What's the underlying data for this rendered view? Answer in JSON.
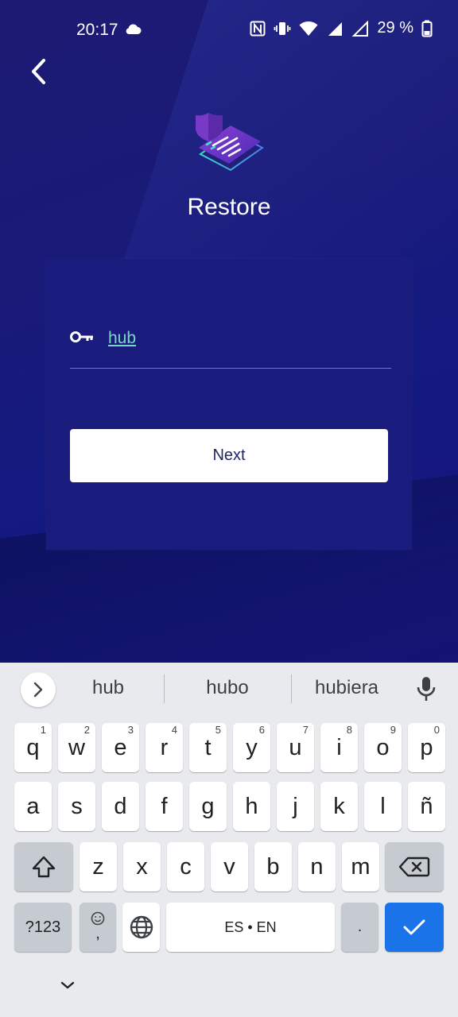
{
  "status_bar": {
    "time": "20:17",
    "battery": "29 %"
  },
  "screen": {
    "title": "Restore",
    "field_value": "hub",
    "next_label": "Next"
  },
  "keyboard": {
    "suggestions": [
      "hub",
      "hubo",
      "hubiera"
    ],
    "row1": [
      {
        "k": "q",
        "h": "1"
      },
      {
        "k": "w",
        "h": "2"
      },
      {
        "k": "e",
        "h": "3"
      },
      {
        "k": "r",
        "h": "4"
      },
      {
        "k": "t",
        "h": "5"
      },
      {
        "k": "y",
        "h": "6"
      },
      {
        "k": "u",
        "h": "7"
      },
      {
        "k": "i",
        "h": "8"
      },
      {
        "k": "o",
        "h": "9"
      },
      {
        "k": "p",
        "h": "0"
      }
    ],
    "row2": [
      "a",
      "s",
      "d",
      "f",
      "g",
      "h",
      "j",
      "k",
      "l",
      "ñ"
    ],
    "row3": [
      "z",
      "x",
      "c",
      "v",
      "b",
      "n",
      "m"
    ],
    "symbols_label": "?123",
    "comma_label": ",",
    "space_label": "ES • EN",
    "period_label": "."
  },
  "colors": {
    "background": "#1a1a78",
    "accent": "#7ad9c3",
    "keyboard_action": "#1a73e8"
  },
  "icons": [
    "cloud-icon",
    "nfc-icon",
    "vibrate-icon",
    "wifi-icon",
    "signal-icon",
    "battery-icon",
    "back-arrow-icon",
    "restore-logo-icon",
    "key-icon",
    "chevron-right-icon",
    "mic-icon",
    "shift-icon",
    "backspace-icon",
    "emoji-icon",
    "globe-icon",
    "checkmark-icon",
    "chevron-down-icon"
  ]
}
